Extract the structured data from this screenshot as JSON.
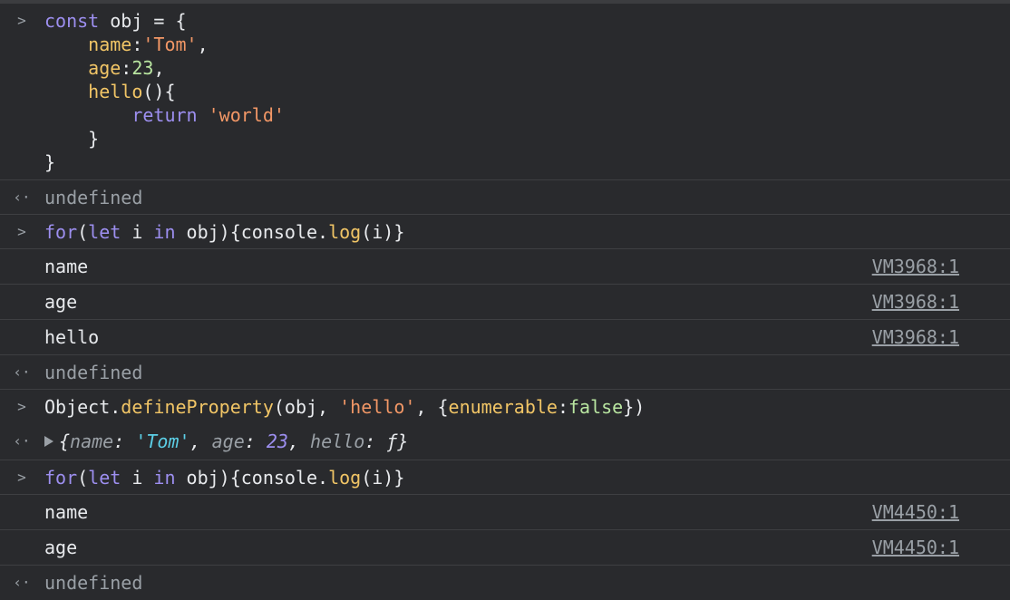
{
  "icons": {
    "input_prompt": "chevron-right-icon",
    "result_prompt": "return-arrow-icon",
    "expand": "triangle-right-icon"
  },
  "entries": {
    "e1": {
      "lines": [
        "const obj = {",
        "    name:'Tom',",
        "    age:23,",
        "    hello(){",
        "        return 'world'",
        "    }",
        "}"
      ]
    },
    "r1": {
      "text": "undefined"
    },
    "e2": {
      "text": "for(let i in obj){console.log(i)}"
    },
    "logs1": [
      {
        "text": "name",
        "source": "VM3968:1"
      },
      {
        "text": "age",
        "source": "VM3968:1"
      },
      {
        "text": "hello",
        "source": "VM3968:1"
      }
    ],
    "r2": {
      "text": "undefined"
    },
    "e3": {
      "text": "Object.defineProperty(obj, 'hello', {enumerable:false})"
    },
    "r3": {
      "key1": "name",
      "val1": "'Tom'",
      "key2": "age",
      "val2": "23",
      "key3": "hello",
      "val3": "ƒ"
    },
    "e4": {
      "text": "for(let i in obj){console.log(i)}"
    },
    "logs2": [
      {
        "text": "name",
        "source": "VM4450:1"
      },
      {
        "text": "age",
        "source": "VM4450:1"
      }
    ],
    "r4": {
      "text": "undefined"
    }
  },
  "symbols": {
    "gt": ">",
    "lt": "‹·"
  }
}
